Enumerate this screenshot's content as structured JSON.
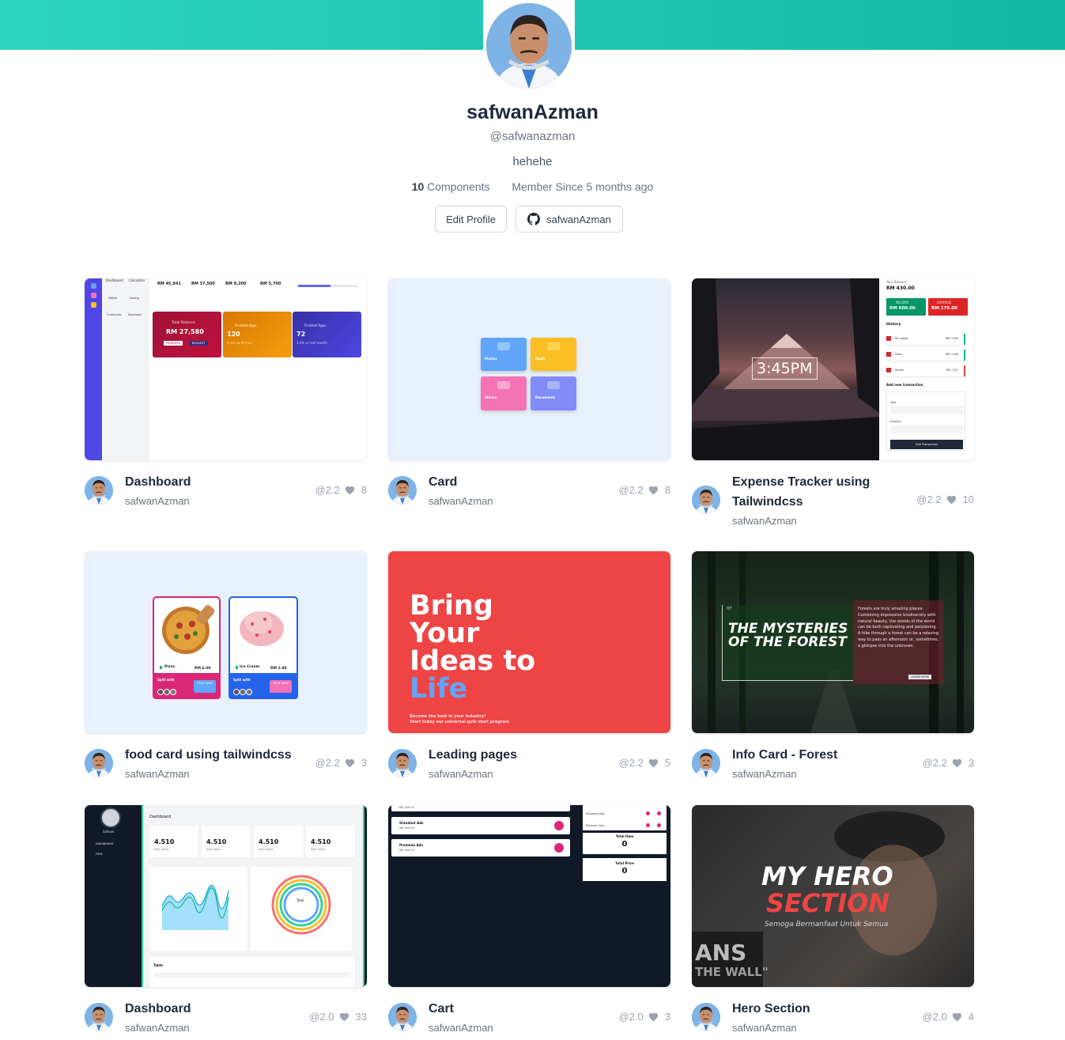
{
  "profile": {
    "name": "safwanAzman",
    "handle": "@safwanazman",
    "bio": "hehehe",
    "components_count": "10",
    "components_label": "Components",
    "member_since": "Member Since 5 months ago",
    "edit_label": "Edit Profile",
    "github_label": "safwanAzman"
  },
  "colors": {
    "accent": "#14b8a6",
    "accent_light": "#2dd4bf"
  },
  "cards": [
    {
      "title": "Dashboard",
      "author": "safwanAzman",
      "version": "@2.2",
      "likes": "8"
    },
    {
      "title": "Card",
      "author": "safwanAzman",
      "version": "@2.2",
      "likes": "8"
    },
    {
      "title": "Expense Tracker using",
      "title2": "Tailwindcss",
      "author": "safwanAzman",
      "version": "@2.2",
      "likes": "10"
    },
    {
      "title": "food card using tailwindcss",
      "author": "safwanAzman",
      "version": "@2.2",
      "likes": "3"
    },
    {
      "title": "Leading pages",
      "author": "safwanAzman",
      "version": "@2.2",
      "likes": "5"
    },
    {
      "title": "Info Card - Forest",
      "author": "safwanAzman",
      "version": "@2.2",
      "likes": "3"
    },
    {
      "title": "Dashboard",
      "author": "safwanAzman",
      "version": "@2.0",
      "likes": "33"
    },
    {
      "title": "Cart",
      "author": "safwanAzman",
      "version": "@2.0",
      "likes": "3"
    },
    {
      "title": "Hero Section",
      "author": "safwanAzman",
      "version": "@2.0",
      "likes": "4"
    }
  ],
  "previews": {
    "dash1": {
      "sidebar": [
        "Dashboard",
        "Calculator",
        "Wallet",
        "Saving",
        "Currencies",
        "Expenses"
      ],
      "stats": [
        "RM 45,941",
        "RM 37,500",
        "RM 9,200",
        "RM 5,700"
      ],
      "balance_label": "Total Balance",
      "balance": "RM 27,580",
      "transfer": "TRANSFER",
      "request": "REQUEST",
      "apps_label": "Finished Apps",
      "apps1": "120",
      "apps1_sub": "4 not confirmed",
      "apps2": "72",
      "apps2_sub": "3.4% vs last month"
    },
    "card": {
      "photos": "Photos",
      "music": "Music",
      "videos": "Videos",
      "documents": "Documents"
    },
    "expense": {
      "time": "3:45PM",
      "balance_label": "Your Balance",
      "balance": "RM 430.00",
      "income_label": "INCOME",
      "income": "RM 600.00",
      "expense_label": "EXPENSE",
      "expense": "RM 170.00",
      "history": "History",
      "items": [
        [
          "My wallet",
          "RM +400"
        ],
        [
          "Desk",
          "RM +200"
        ],
        [
          "Wheel",
          "RM -170"
        ]
      ],
      "add": "Add new transaction",
      "text_label": "Text",
      "amount_label": "Amount",
      "button": "Add Transaction"
    },
    "food": {
      "item1": "Pizza",
      "price1": "RM 6.00",
      "item2": "Ice Cream",
      "price2": "RM 2.00",
      "split": "Split with",
      "split_now": "SPLIT NOW"
    },
    "leading": {
      "line1": "Bring",
      "line2": "Your",
      "line3": "Ideas to",
      "line4": "Life",
      "sub1": "Become the best in your industry!",
      "sub2": "Start today our universal quik start program"
    },
    "forest": {
      "title1": "THE MYSTERIES",
      "title2": "OF THE FOREST",
      "num": "07",
      "desc": "Forests are truly amazing places. Combining impressive biodiversity with natural beauty, the woods of the world can be both captivating and perplexing. A hike through a forest can be a relaxing way to pass an afternoon or, sometimes, a glimpse into the unknown.",
      "button": "LEARN MORE"
    },
    "dash2": {
      "title": "Dashboard",
      "user": "Safwan",
      "nav1": "DASHBOARD",
      "nav2": "ITEM",
      "stat": "4.510",
      "stat_sub": "Item Sales",
      "table": "Table",
      "total": "Total"
    },
    "cart": {
      "standout": "Standout Ads",
      "premium": "Premium Ads",
      "price": "RM 500.00",
      "total_item": "Total Item",
      "total_item_val": "0",
      "total_price": "Total Price",
      "total_price_val": "0"
    },
    "hero": {
      "line1": "MY HERO",
      "line2": "SECTION",
      "sub": "Semoga Bermanfaat Untuk Semua",
      "bg1": "ANS",
      "bg2": "THE WALL\""
    }
  }
}
